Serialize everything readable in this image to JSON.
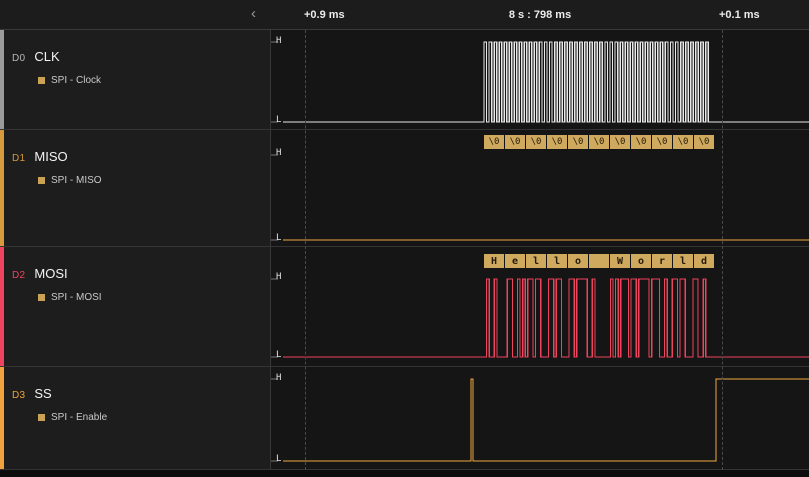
{
  "header": {
    "center_time": "8 s : 798 ms",
    "left_offset": "+0.9 ms",
    "right_offset": "+0.1 ms",
    "collapse_glyph": "‹"
  },
  "levels": {
    "high": "H",
    "low": "L"
  },
  "channels": [
    {
      "id": "D0",
      "name": "CLK",
      "analyzer": "SPI - Clock",
      "color": "#e8e8e8",
      "stripe": "#9b9b9b",
      "id_color": "#b8b8b8"
    },
    {
      "id": "D1",
      "name": "MISO",
      "analyzer": "SPI - MISO",
      "color": "#f0a73e",
      "stripe": "#d6993e",
      "id_color": "#d6993e"
    },
    {
      "id": "D2",
      "name": "MOSI",
      "analyzer": "SPI - MOSI",
      "color": "#f0435f",
      "stripe": "#f0435f",
      "id_color": "#f0435f"
    },
    {
      "id": "D3",
      "name": "SS",
      "analyzer": "SPI - Enable",
      "color": "#f0a73e",
      "stripe": "#f0a33d",
      "id_color": "#f0a33d"
    }
  ],
  "decoders": {
    "miso_bytes": [
      "\\0",
      "\\0",
      "\\0",
      "\\0",
      "\\0",
      "\\0",
      "\\0",
      "\\0",
      "\\0",
      "\\0",
      "\\0"
    ],
    "mosi_chars": [
      "H",
      "e",
      "l",
      "l",
      "o",
      " ",
      "W",
      "o",
      "r",
      "l",
      "d"
    ],
    "mosi_text": "Hello World",
    "box_color": "#cfa95e",
    "box_text_color": "#241a07",
    "bullet_color": "#c9a254"
  },
  "waveform": {
    "clock_cycles": 45
  }
}
